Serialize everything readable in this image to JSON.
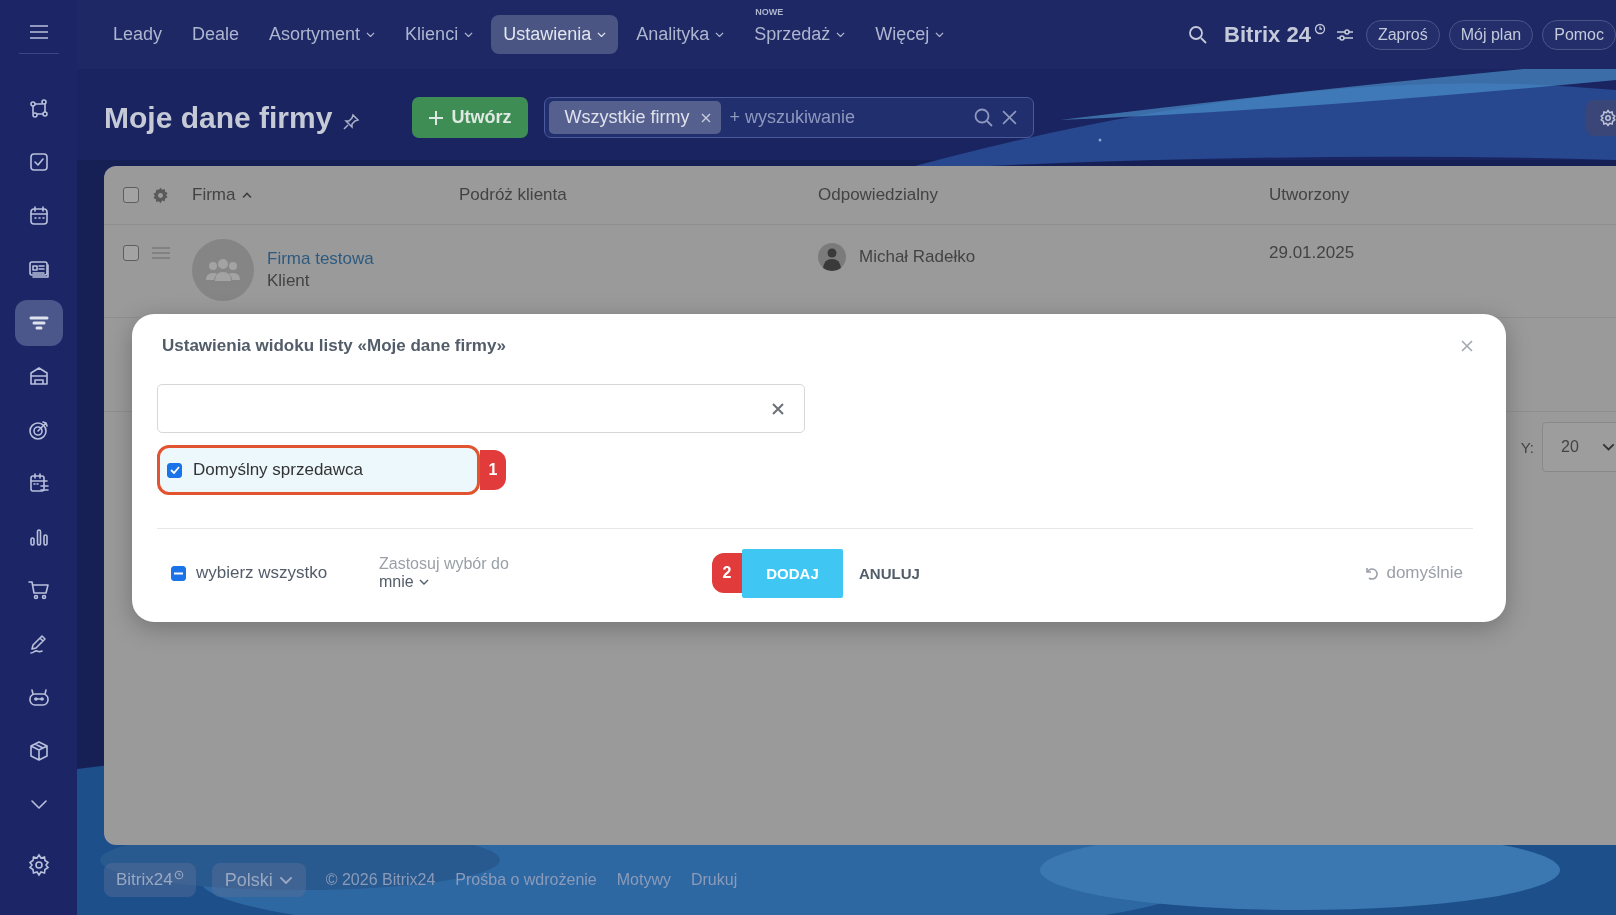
{
  "sidebar": {
    "items": [
      {
        "selected": false
      },
      {
        "selected": false
      },
      {
        "selected": false
      },
      {
        "selected": false
      },
      {
        "selected": true
      },
      {
        "selected": false
      },
      {
        "selected": false
      },
      {
        "selected": false
      },
      {
        "selected": false
      },
      {
        "selected": false
      },
      {
        "selected": false
      },
      {
        "selected": false
      },
      {
        "selected": false
      },
      {
        "selected": false
      }
    ]
  },
  "nav": {
    "items": [
      {
        "label": "Leady",
        "dropdown": false,
        "selected": false
      },
      {
        "label": "Deale",
        "dropdown": false,
        "selected": false
      },
      {
        "label": "Asortyment",
        "dropdown": true,
        "selected": false
      },
      {
        "label": "Klienci",
        "dropdown": true,
        "selected": false
      },
      {
        "label": "Ustawienia",
        "dropdown": true,
        "selected": true
      },
      {
        "label": "Analityka",
        "dropdown": true,
        "selected": false
      },
      {
        "label": "Sprzedaż",
        "dropdown": true,
        "selected": false,
        "badge": "NOWE"
      },
      {
        "label": "Więcej",
        "dropdown": true,
        "selected": false
      }
    ],
    "brand": "Bitrix 24",
    "buttons": [
      "Zaproś",
      "Mój plan",
      "Pomoc"
    ]
  },
  "header": {
    "title": "Moje dane firmy",
    "create_button": "Utwórz",
    "filter": {
      "tag": "Wszystkie firmy",
      "placeholder": "+ wyszukiwanie"
    }
  },
  "table": {
    "columns": [
      {
        "label": "Firma",
        "sorted": true
      },
      {
        "label": "Podróż klienta",
        "sorted": false
      },
      {
        "label": "Odpowiedzialny",
        "sorted": false
      },
      {
        "label": "Utworzony",
        "sorted": false
      }
    ],
    "rows": [
      {
        "checked": false,
        "name": "Firma testowa",
        "type": "Klient",
        "responsible": "Michał Radełko",
        "created": "29.01.2025"
      }
    ],
    "select_all_checked": false,
    "page_size_label": "Y:",
    "page_size": "20"
  },
  "dialog": {
    "title": "Ustawienia widoku listy «Moje dane firmy»",
    "fields": [
      {
        "label": "Domyślny sprzedawca",
        "checked": true,
        "highlighted": true,
        "marker": "1"
      }
    ],
    "select_all": {
      "label": "wybierz wszystko",
      "indeterminate": true
    },
    "apply_label": "Zastosuj wybór do",
    "apply_value": "mnie",
    "add_button": {
      "label": "DODAJ",
      "marker": "2"
    },
    "cancel_button": "ANULUJ",
    "reset": "domyślnie"
  },
  "footer": {
    "brand": "Bitrix24",
    "language": "Polski",
    "links": [
      "© 2026 Bitrix24",
      "Prośba o wdrożenie",
      "Motywy",
      "Drukuj"
    ]
  }
}
